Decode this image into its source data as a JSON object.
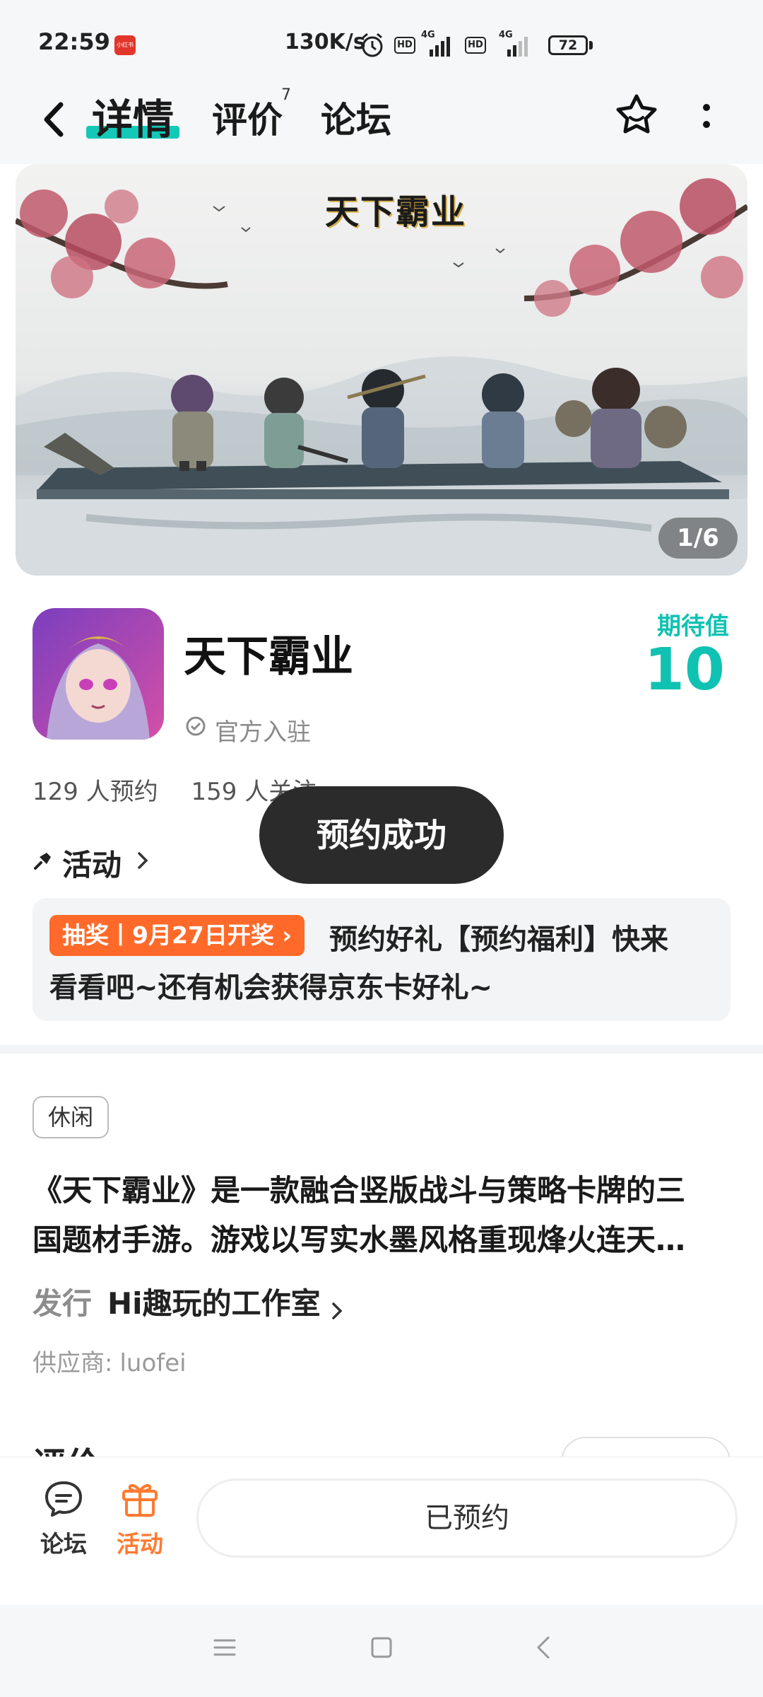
{
  "status_bar": {
    "time": "22:59",
    "app_icon_text": "小红书",
    "net_speed": "130K/s",
    "hd_label": "HD",
    "network_label": "4G",
    "battery": "72"
  },
  "nav": {
    "tabs": [
      {
        "label": "详情",
        "active": true
      },
      {
        "label": "评价",
        "badge": "7"
      },
      {
        "label": "论坛"
      }
    ]
  },
  "banner": {
    "logo_text": "天下霸业",
    "counter": "1/6"
  },
  "game": {
    "title": "天下霸业",
    "verified": "官方入驻",
    "expect_label": "期待值",
    "expect_value": "10",
    "reservations": "129 人预约",
    "followers": "159 人关注"
  },
  "activity": {
    "header": "活动",
    "tag": "抽奖丨9月27日开奖",
    "text_line1": "预约好礼【预约福利】快来",
    "text_line2": "看看吧~还有机会获得京东卡好礼~"
  },
  "description": {
    "genre": "休闲",
    "line1": "《天下霸业》是一款融合竖版战斗与策略卡牌的三",
    "line2": "国题材手游。游戏以写实水墨风格重现烽火连天…",
    "publisher_label": "发行",
    "publisher_name": "Hi趣玩的工作室",
    "supplier_label": "供应商:",
    "supplier_name": "luofei",
    "next_section_title": "评价"
  },
  "bottom_bar": {
    "forum_label": "论坛",
    "activity_label": "活动",
    "reserved_button": "已预约"
  },
  "toast": "预约成功",
  "colors": {
    "accent_teal": "#14c8b8",
    "accent_orange": "#ff6a2a"
  }
}
